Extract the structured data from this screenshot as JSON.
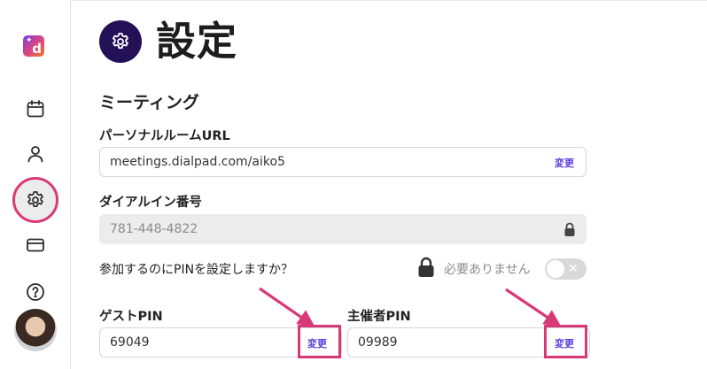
{
  "app": {
    "logo_letter": "d",
    "logo_spark": "✦"
  },
  "sidebar": {
    "items": [
      {
        "name": "calendar-icon"
      },
      {
        "name": "user-icon"
      },
      {
        "name": "settings-icon",
        "active": true
      },
      {
        "name": "credit-card-icon"
      },
      {
        "name": "help-icon"
      }
    ]
  },
  "header": {
    "title": "設定",
    "icon": "gear-icon"
  },
  "meeting": {
    "section_title": "ミーティング",
    "personal_room_url": {
      "label": "パーソナルルームURL",
      "value": "meetings.dialpad.com/aiko5",
      "change_label": "変更"
    },
    "dial_in_number": {
      "label": "ダイアルイン番号",
      "value": "781-448-4822",
      "icon": "lock-icon"
    },
    "pin_setting": {
      "question": "参加するのにPINを設定しますか？",
      "status_text": "必要ありません",
      "toggle_state": "off",
      "toggle_glyph": "✕"
    },
    "guest_pin": {
      "label": "ゲストPIN",
      "value": "69049",
      "change_label": "変更"
    },
    "host_pin": {
      "label": "主催者PIN",
      "value": "09989",
      "change_label": "変更"
    }
  },
  "colors": {
    "accent": "#5a3ee0",
    "highlight": "#d83a78",
    "title_icon_bg": "#241057"
  }
}
